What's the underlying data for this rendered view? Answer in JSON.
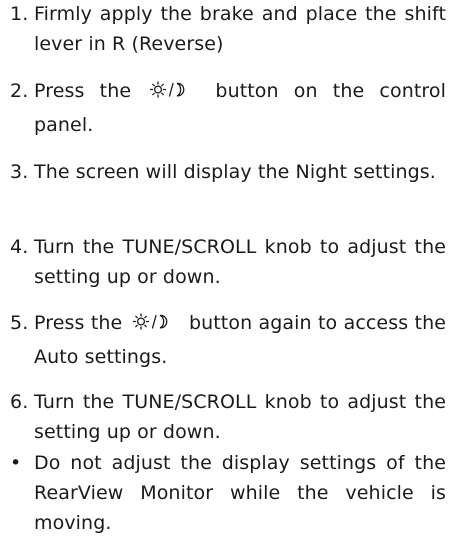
{
  "steps": [
    {
      "num": "1.",
      "text": "Firmly apply the brake and place the shift lever in R (Reverse)"
    },
    {
      "num": "2.",
      "before": "Press the",
      "icon": "sun-moon-icon",
      "after": "button on the control panel."
    },
    {
      "num": "3.",
      "text": "The screen will display the Night settings."
    },
    {
      "num": "4.",
      "text": "Turn the TUNE/SCROLL knob to adjust the setting up or down."
    },
    {
      "num": "5.",
      "before": "Press the",
      "icon": "sun-moon-icon",
      "after": "button again to access the Auto settings."
    },
    {
      "num": "6.",
      "text": "Turn the TUNE/SCROLL knob to adjust the setting up or down."
    }
  ],
  "bullet": {
    "marker": "•",
    "text": "Do not adjust the display settings of the RearView Monitor while the vehicle is moving."
  }
}
